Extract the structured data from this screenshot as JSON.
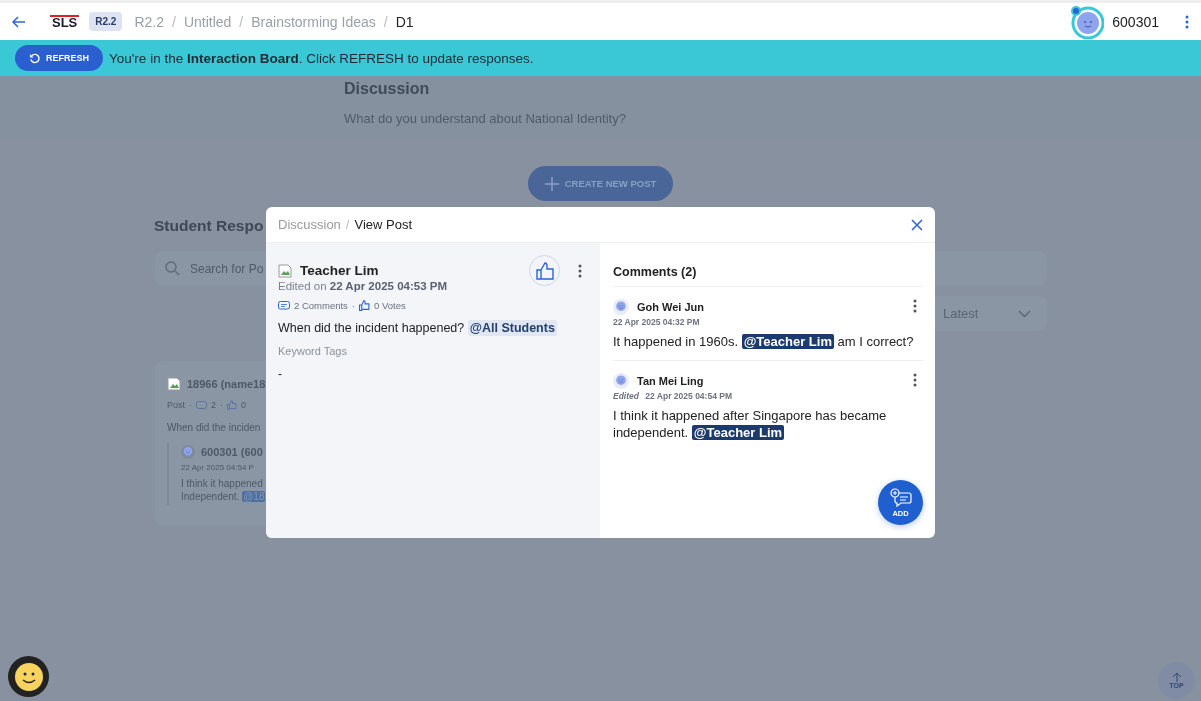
{
  "header": {
    "logo": "SLS",
    "separator": "/",
    "badge": "R2.2",
    "breadcrumb": [
      {
        "label": "R2.2",
        "current": false
      },
      {
        "label": "Untitled",
        "current": false
      },
      {
        "label": "Brainstorming Ideas",
        "current": false
      },
      {
        "label": "D1",
        "current": true
      }
    ],
    "user": "600301"
  },
  "banner": {
    "button": "REFRESH",
    "message": "You're in the **Interaction Board**. Click REFRESH to update responses."
  },
  "discussion": {
    "title": "Discussion",
    "question": "What do you understand about National Identity?"
  },
  "create_button": "CREATE NEW POST",
  "responses": {
    "title": "Student Respo",
    "search_placeholder": "Search for Po",
    "sort": "Latest",
    "post": {
      "author": "18966 (name18",
      "meta": [
        "Post",
        "2",
        "0"
      ],
      "dot": "·",
      "text": "When did the inciden",
      "reply": {
        "author": "600301 (600",
        "time": "22 Apr 2025 04:54 P",
        "lines": [
          "I think it happened",
          "Independent."
        ],
        "mention": "@18"
      }
    }
  },
  "top_button": "TOP",
  "modal": {
    "separator": "/",
    "dot": "·",
    "breadcrumb": [
      {
        "label": "Discussion",
        "current": false
      },
      {
        "label": "View Post",
        "current": true
      }
    ],
    "post": {
      "author": "Teacher Lim",
      "edited_label": "Edited on",
      "time": "22 Apr 2025 04:53 PM",
      "comments": "2 Comments",
      "votes": "0 Votes",
      "text": [
        {
          "kind": "text",
          "text": "When did the incident happened?"
        },
        {
          "kind": "mention",
          "text": "@All Students"
        }
      ],
      "tags_label": "Keyword Tags",
      "tags": "-"
    },
    "comments_title": "Comments (2)",
    "comments": [
      {
        "author": "Goh Wei Jun",
        "time": "22 Apr 2025 04:32 PM",
        "text": [
          {
            "kind": "text",
            "text": "It happened in 1960s."
          },
          {
            "kind": "mention",
            "text": "@Teacher Lim"
          },
          {
            "kind": "text",
            "text": "am I correct?"
          }
        ]
      },
      {
        "author": "Tan Mei Ling",
        "edited_label": "Edited",
        "time": "22 Apr 2025 04:54 PM",
        "text": [
          {
            "kind": "text",
            "text": "I think it happened after Singapore has became independent."
          },
          {
            "kind": "mention",
            "text": "@Teacher Lim"
          }
        ]
      }
    ],
    "add_button": "ADD"
  }
}
